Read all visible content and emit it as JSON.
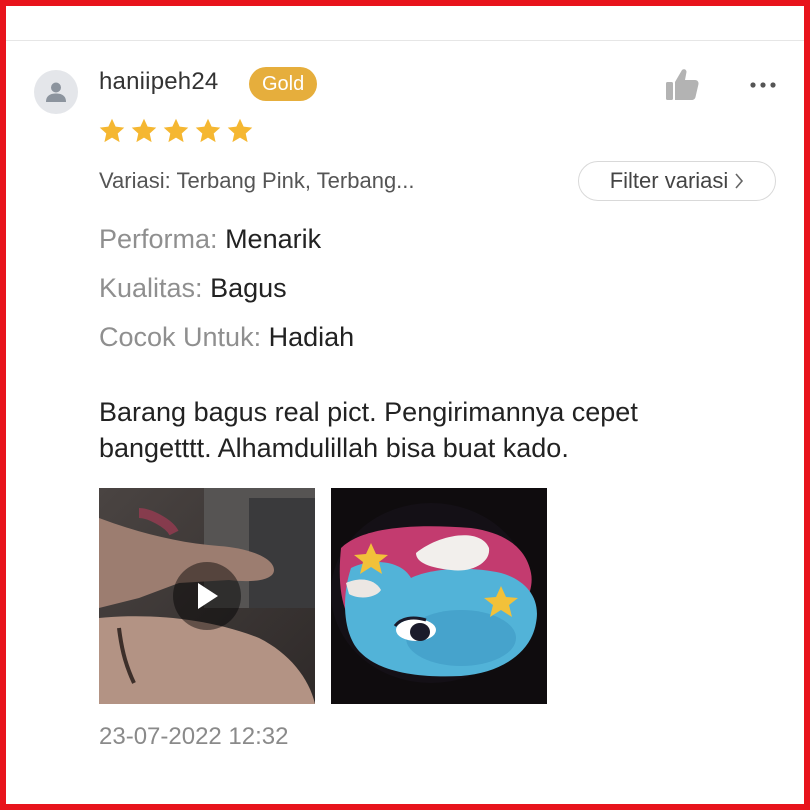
{
  "review": {
    "username": "haniipeh24",
    "badge": "Gold",
    "rating": 5,
    "variation": "Variasi: Terbang Pink, Terbang...",
    "filter_label": "Filter variasi",
    "attributes": [
      {
        "key": "Performa:",
        "value": "Menarik"
      },
      {
        "key": "Kualitas:",
        "value": "Bagus"
      },
      {
        "key": "Cocok Untuk:",
        "value": "Hadiah"
      }
    ],
    "text_line1": "Barang bagus real pict. Pengirimannya cepet",
    "text_line2": "bangetttt. Alhamdulillah bisa buat kado.",
    "timestamp": "23-07-2022 12:32"
  },
  "icons": {
    "avatar": "user-icon",
    "like": "thumbs-up-icon",
    "more": "more-icon",
    "star": "star-icon",
    "chevron": "chevron-right-icon",
    "play": "play-icon"
  },
  "colors": {
    "badge": "#e6ae3c",
    "star": "#f5b731",
    "frame": "#e8141c"
  }
}
